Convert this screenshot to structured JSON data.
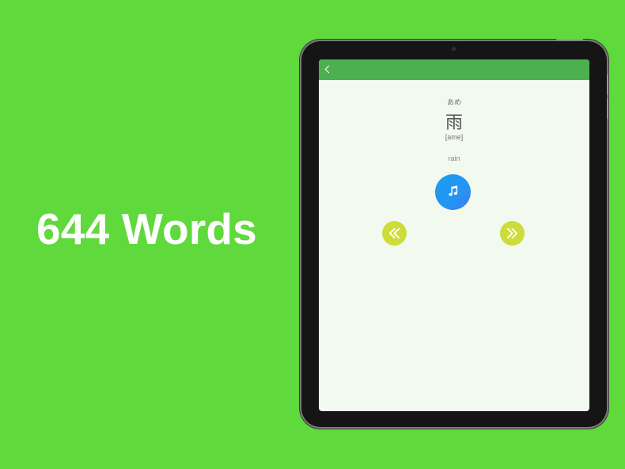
{
  "headline": "644 Words",
  "colors": {
    "background": "#5fd93b",
    "app_bar": "#4caf50",
    "screen_bg": "#f2f9ef",
    "audio_button": "#2196f3",
    "nav_buttons": "#cddc39"
  },
  "app": {
    "app_bar": {
      "back_icon": "chevron-left-icon"
    },
    "card": {
      "kana": "あめ",
      "kanji": "雨",
      "romaji": "[ame]",
      "meaning": "rain"
    },
    "audio_button_icon": "music-note-icon",
    "prev_button_icon": "double-chevron-left-icon",
    "next_button_icon": "double-chevron-right-icon"
  }
}
